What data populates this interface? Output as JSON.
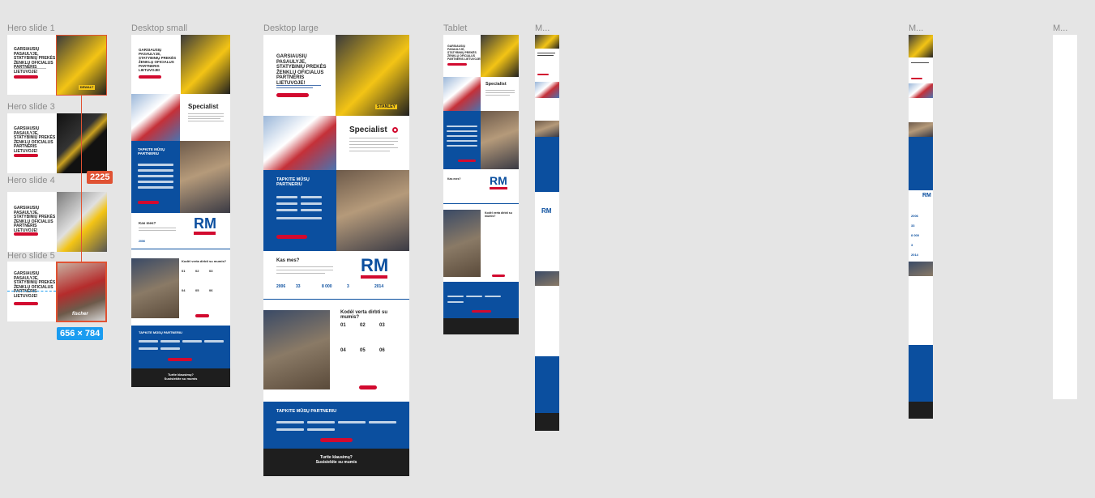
{
  "frames": [
    {
      "id": "hero1",
      "label": "Hero slide 1"
    },
    {
      "id": "hero3",
      "label": "Hero slide 3"
    },
    {
      "id": "hero4",
      "label": "Hero slide 4"
    },
    {
      "id": "hero5",
      "label": "Hero slide 5"
    },
    {
      "id": "desk_small",
      "label": "Desktop small"
    },
    {
      "id": "desk_large",
      "label": "Desktop large"
    },
    {
      "id": "tablet",
      "label": "Tablet"
    },
    {
      "id": "m1",
      "label": "M..."
    },
    {
      "id": "m2",
      "label": "M..."
    },
    {
      "id": "m3",
      "label": "M..."
    }
  ],
  "selection": {
    "distance": "2225",
    "size": "656 × 784"
  },
  "hero": {
    "headline": "GARSIAUSIŲ PASAULYJE, STATYBINIŲ PREKĖS ŽENKLŲ OFICIALUS PARTNERIS LIETUVOJE!",
    "cta": "Susisiekite su mumis",
    "brand_stanley": "STANLEY",
    "brand_fischer": "fischer"
  },
  "sections": {
    "specialist": "Specialist",
    "partner_title": "TAPKITE MŪSŲ PARTNERIU",
    "about_title": "Kas mes?",
    "rm_logo": "RM",
    "rm_sub": "TOOLS",
    "why_title": "Kodėl verta dirbti su mumis?",
    "why_nums": [
      "01",
      "02",
      "03",
      "04",
      "05",
      "06"
    ],
    "stats": [
      "2006",
      "33",
      "8 000",
      "3",
      "2014"
    ],
    "footer_line1": "Turite klausimų?",
    "footer_line2": "Susisiekite su mumis",
    "partner_bottom": "TAPKITE MŪSŲ PARTNERIU"
  },
  "colors": {
    "canvas": "#e5e5e5",
    "accent": "#e05233",
    "selection_badge": "#1a9cf0",
    "brand_red": "#d20a2f",
    "brand_blue": "#0b4f9f"
  }
}
